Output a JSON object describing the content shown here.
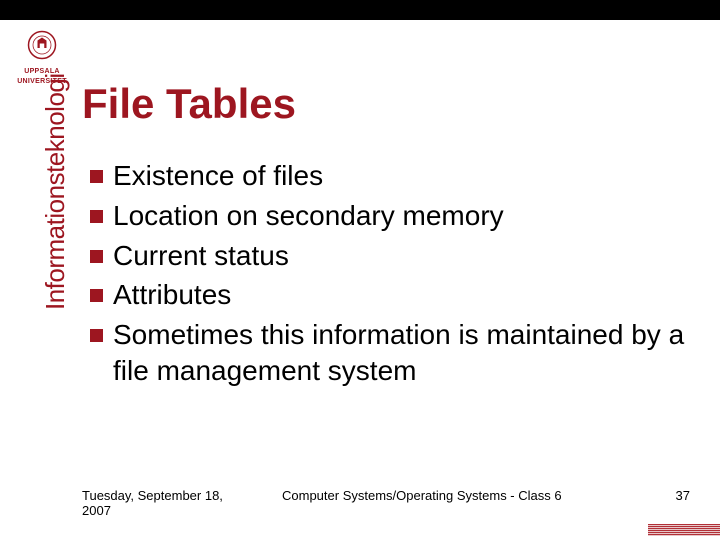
{
  "university": {
    "name": "UPPSALA",
    "subname": "UNIVERSITET"
  },
  "title": "File Tables",
  "sidebar_label": "Informationsteknologi",
  "bullets": [
    "Existence of files",
    "Location on secondary memory",
    "Current status",
    "Attributes",
    "Sometimes this information is maintained by a file management system"
  ],
  "footer": {
    "date": "Tuesday, September 18, 2007",
    "center": "Computer Systems/Operating Systems - Class 6",
    "page": "37"
  },
  "colors": {
    "accent": "#9d1620"
  }
}
